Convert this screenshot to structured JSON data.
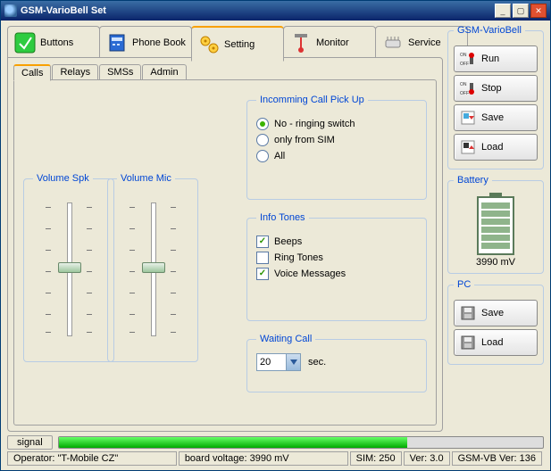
{
  "window": {
    "title": "GSM-VarioBell Set"
  },
  "toptabs": {
    "buttons": {
      "label": "Buttons"
    },
    "phonebook": {
      "label": "Phone Book"
    },
    "setting": {
      "label": "Setting"
    },
    "monitor": {
      "label": "Monitor"
    },
    "service": {
      "label": "Service"
    }
  },
  "subtabs": {
    "calls": {
      "label": "Calls"
    },
    "relays": {
      "label": "Relays"
    },
    "smss": {
      "label": "SMSs"
    },
    "admin": {
      "label": "Admin"
    }
  },
  "volume_spk": {
    "legend": "Volume Spk"
  },
  "volume_mic": {
    "legend": "Volume Mic"
  },
  "incoming": {
    "legend": "Incomming Call Pick Up",
    "opt_no": "No - ringing switch",
    "opt_sim": "only from SIM",
    "opt_all": "All",
    "selected": "no"
  },
  "info_tones": {
    "legend": "Info Tones",
    "beeps": {
      "label": "Beeps",
      "checked": true
    },
    "ring": {
      "label": "Ring Tones",
      "checked": false
    },
    "voice": {
      "label": "Voice Messages",
      "checked": true
    }
  },
  "waiting": {
    "legend": "Waiting Call",
    "value": "20",
    "unit": "sec."
  },
  "right": {
    "gsm_legend": "GSM-VarioBell",
    "run": "Run",
    "stop": "Stop",
    "save": "Save",
    "load": "Load",
    "on": "ON",
    "off": "OFF",
    "battery_legend": "Battery",
    "battery_mv": "3990 mV",
    "pc_legend": "PC",
    "pc_save": "Save",
    "pc_load": "Load"
  },
  "status": {
    "signal_label": "signal",
    "signal_pct": 72,
    "operator": "Operator: \"T-Mobile CZ\"",
    "board_volt": "board voltage: 3990 mV",
    "sim": "SIM: 250",
    "ver": "Ver: 3.0",
    "gsmvb_ver": "GSM-VB Ver: 136"
  }
}
